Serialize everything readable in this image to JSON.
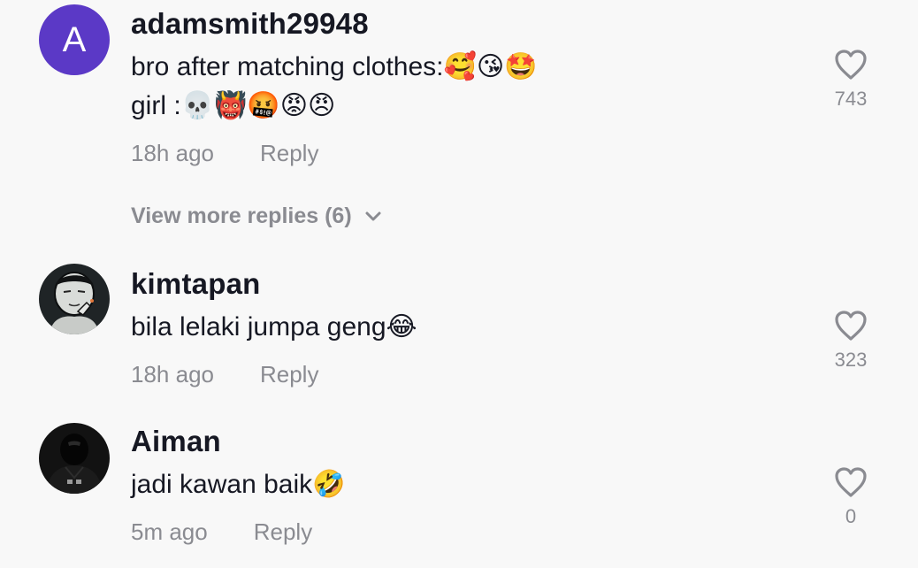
{
  "comments": [
    {
      "avatar_letter": "A",
      "avatar_color": "#5b39c6",
      "username": "adamsmith29948",
      "lines": [
        "bro after matching clothes:🥰😘🤩",
        "girl :💀👹🤬😡😠"
      ],
      "time": "18h ago",
      "reply_label": "Reply",
      "likes": "743",
      "view_more": "View more replies (6)"
    },
    {
      "username": "kimtapan",
      "lines": [
        "bila lelaki jumpa geng😂"
      ],
      "time": "18h ago",
      "reply_label": "Reply",
      "likes": "323"
    },
    {
      "username": "Aiman",
      "lines": [
        "jadi kawan baik🤣"
      ],
      "time": "5m ago",
      "reply_label": "Reply",
      "likes": "0"
    }
  ],
  "icons": {
    "like": "heart-outline-icon",
    "expand": "chevron-down-icon"
  },
  "colors": {
    "background": "#f8f8f8",
    "primary_text": "#161823",
    "secondary_text": "#8a8b91",
    "avatar_purple": "#5b39c6"
  }
}
